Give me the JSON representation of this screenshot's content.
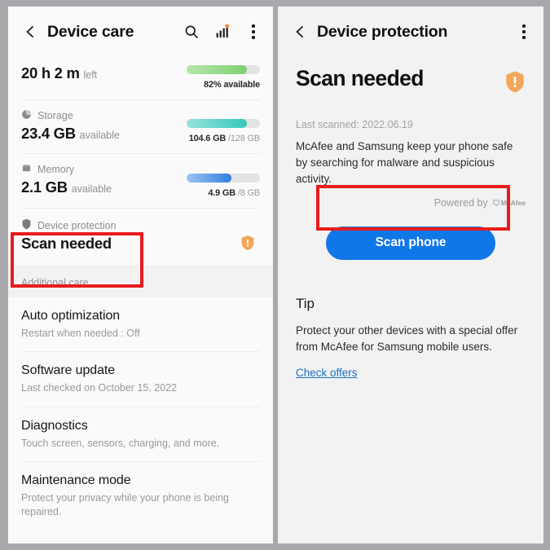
{
  "colors": {
    "accent_blue": "#1077e8",
    "highlight_red": "#e81c1c",
    "warning_orange": "#f2a65a",
    "battery_green": "#7ed072",
    "storage_teal": "#37c8bd",
    "memory_blue": "#2f7fe0",
    "link_blue": "#1a6fc4"
  },
  "left_panel": {
    "appbar": {
      "back_icon": "back-chevron-icon",
      "title": "Device care",
      "actions": [
        {
          "icon": "search-icon",
          "name": "search-button"
        },
        {
          "icon": "bar-chart-icon",
          "name": "usage-chart-button"
        },
        {
          "icon": "kebab-menu-icon",
          "name": "more-options-button"
        }
      ]
    },
    "metrics": [
      {
        "icon": "battery-icon",
        "label": "",
        "value": "20 h 2 m",
        "value_sub": "left",
        "bar_percent": 82,
        "bar_style": "battery",
        "caption_main": "82% available",
        "caption_total": ""
      },
      {
        "icon": "storage-pie-icon",
        "label": "Storage",
        "value": "23.4 GB",
        "value_sub": "available",
        "bar_percent": 82,
        "bar_style": "storage",
        "caption_main": "104.6 GB",
        "caption_total": "/128 GB"
      },
      {
        "icon": "memory-chip-icon",
        "label": "Memory",
        "value": "2.1 GB",
        "value_sub": "available",
        "bar_percent": 61,
        "bar_style": "memory",
        "caption_main": "4.9 GB",
        "caption_total": "/8 GB"
      }
    ],
    "device_protection": {
      "icon": "shield-icon",
      "label": "Device protection",
      "status": "Scan needed",
      "status_icon": "shield-warning-icon"
    },
    "section_header": "Additional care",
    "list_items": [
      {
        "title": "Auto optimization",
        "subtitle": "Restart when needed : Off"
      },
      {
        "title": "Software update",
        "subtitle": "Last checked on October 15, 2022"
      },
      {
        "title": "Diagnostics",
        "subtitle": "Touch screen, sensors, charging, and more."
      },
      {
        "title": "Maintenance mode",
        "subtitle": "Protect your privacy while your phone is being repaired."
      }
    ]
  },
  "right_panel": {
    "appbar": {
      "back_icon": "back-chevron-icon",
      "title": "Device protection",
      "actions": [
        {
          "icon": "kebab-menu-icon",
          "name": "more-options-button"
        }
      ]
    },
    "hero": {
      "title": "Scan needed",
      "status_icon": "shield-warning-icon"
    },
    "last_scanned": "Last scanned: 2022.06.19",
    "description": "McAfee and Samsung keep your phone safe by searching for malware and suspicious activity.",
    "powered_by_label": "Powered by",
    "powered_by_brand": "McAfee",
    "scan_button_label": "Scan phone",
    "tip": {
      "title": "Tip",
      "body": "Protect your other devices with a special offer from McAfee for Samsung mobile users.",
      "link_label": "Check offers"
    }
  }
}
